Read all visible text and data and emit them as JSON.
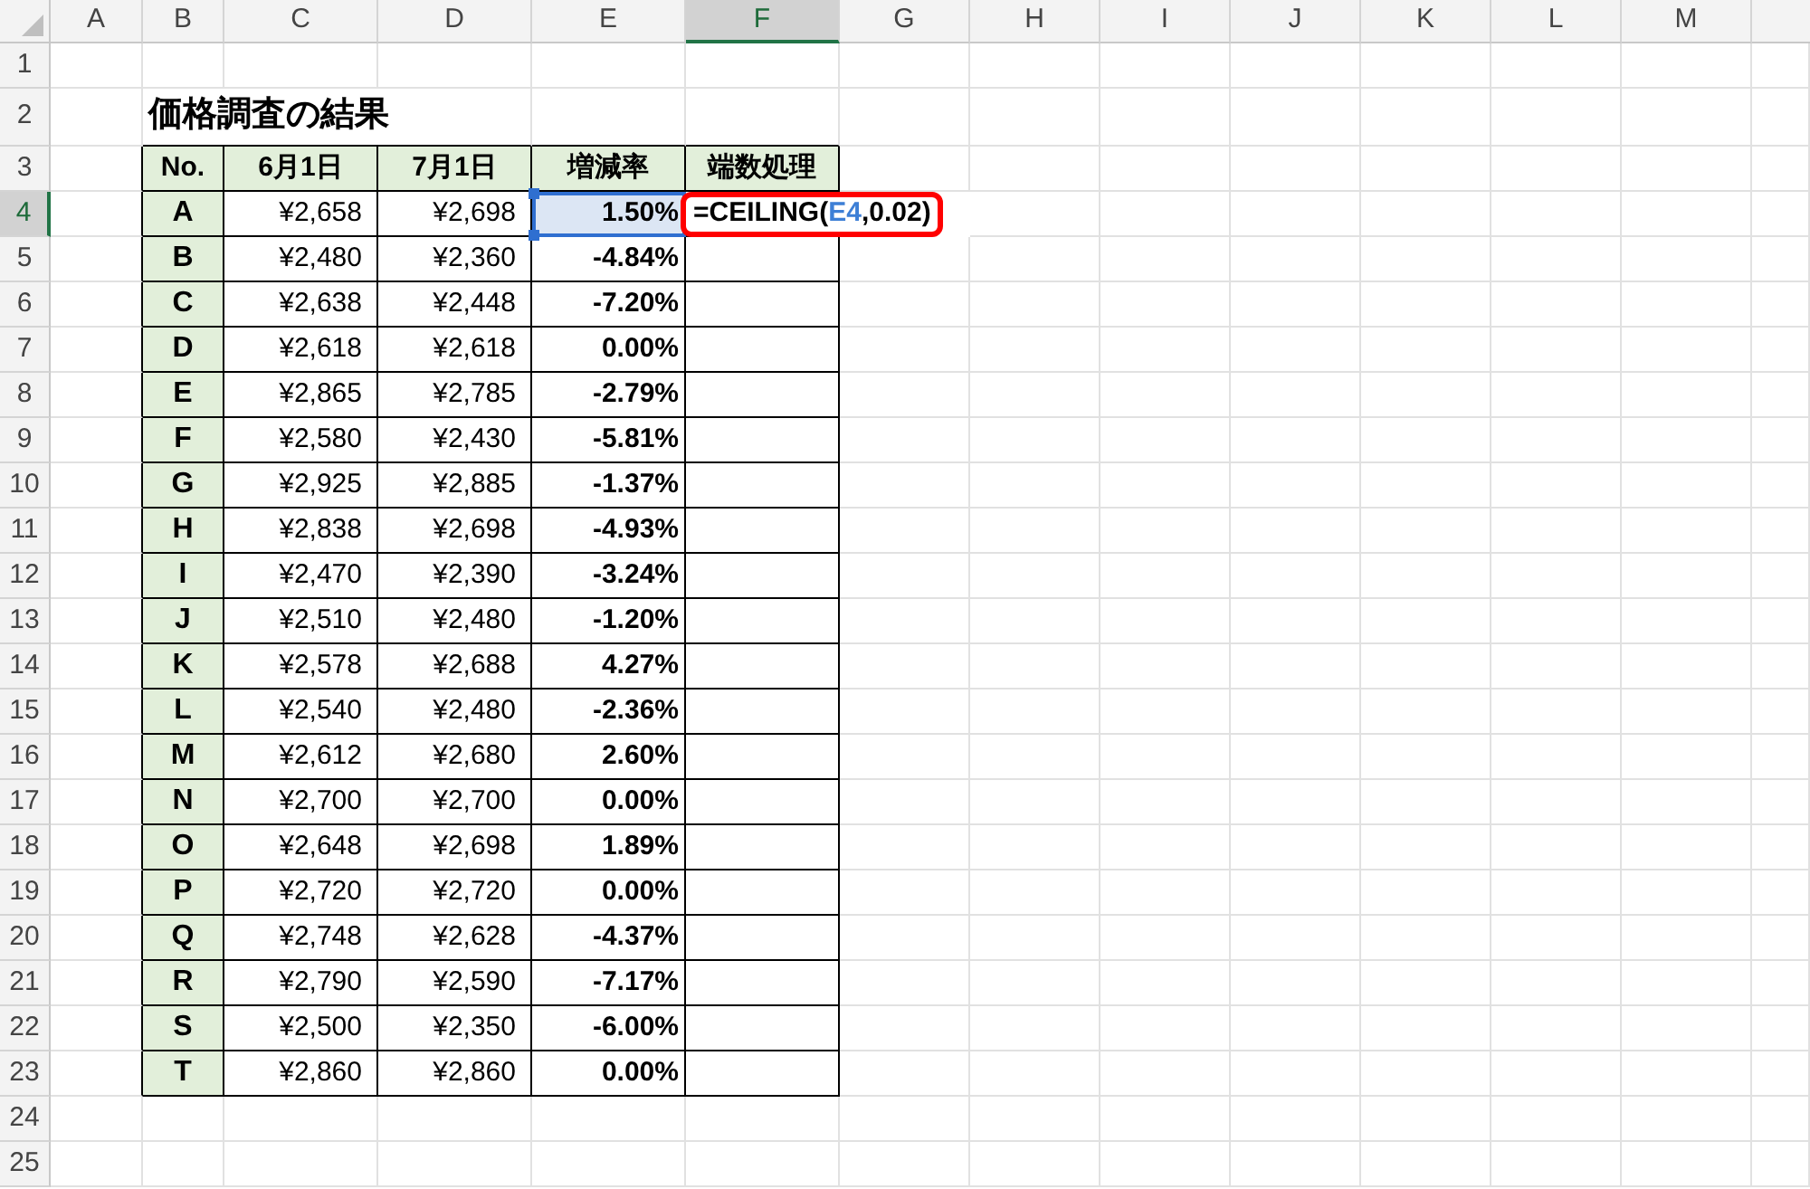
{
  "column_headers": [
    {
      "label": "A",
      "selected": false
    },
    {
      "label": "B",
      "selected": false
    },
    {
      "label": "C",
      "selected": false
    },
    {
      "label": "D",
      "selected": false
    },
    {
      "label": "E",
      "selected": false
    },
    {
      "label": "F",
      "selected": true
    },
    {
      "label": "G",
      "selected": false
    },
    {
      "label": "H",
      "selected": false
    },
    {
      "label": "I",
      "selected": false
    },
    {
      "label": "J",
      "selected": false
    },
    {
      "label": "K",
      "selected": false
    },
    {
      "label": "L",
      "selected": false
    },
    {
      "label": "M",
      "selected": false
    }
  ],
  "row_headers": [
    {
      "label": "1",
      "selected": false
    },
    {
      "label": "2",
      "selected": false
    },
    {
      "label": "3",
      "selected": false
    },
    {
      "label": "4",
      "selected": true
    },
    {
      "label": "5",
      "selected": false
    },
    {
      "label": "6",
      "selected": false
    },
    {
      "label": "7",
      "selected": false
    },
    {
      "label": "8",
      "selected": false
    },
    {
      "label": "9",
      "selected": false
    },
    {
      "label": "10",
      "selected": false
    },
    {
      "label": "11",
      "selected": false
    },
    {
      "label": "12",
      "selected": false
    },
    {
      "label": "13",
      "selected": false
    },
    {
      "label": "14",
      "selected": false
    },
    {
      "label": "15",
      "selected": false
    },
    {
      "label": "16",
      "selected": false
    },
    {
      "label": "17",
      "selected": false
    },
    {
      "label": "18",
      "selected": false
    },
    {
      "label": "19",
      "selected": false
    },
    {
      "label": "20",
      "selected": false
    },
    {
      "label": "21",
      "selected": false
    },
    {
      "label": "22",
      "selected": false
    },
    {
      "label": "23",
      "selected": false
    },
    {
      "label": "24",
      "selected": false
    },
    {
      "label": "25",
      "selected": false
    }
  ],
  "title": "価格調査の結果",
  "table": {
    "columns": [
      "No.",
      "6月1日",
      "7月1日",
      "増減率",
      "端数処理"
    ],
    "rows": [
      {
        "no": "A",
        "june_1": "¥2,658",
        "july_1": "¥2,698",
        "change_rate": "1.50%",
        "selected": true
      },
      {
        "no": "B",
        "june_1": "¥2,480",
        "july_1": "¥2,360",
        "change_rate": "-4.84%",
        "selected": false
      },
      {
        "no": "C",
        "june_1": "¥2,638",
        "july_1": "¥2,448",
        "change_rate": "-7.20%",
        "selected": false
      },
      {
        "no": "D",
        "june_1": "¥2,618",
        "july_1": "¥2,618",
        "change_rate": "0.00%",
        "selected": false
      },
      {
        "no": "E",
        "june_1": "¥2,865",
        "july_1": "¥2,785",
        "change_rate": "-2.79%",
        "selected": false
      },
      {
        "no": "F",
        "june_1": "¥2,580",
        "july_1": "¥2,430",
        "change_rate": "-5.81%",
        "selected": false
      },
      {
        "no": "G",
        "june_1": "¥2,925",
        "july_1": "¥2,885",
        "change_rate": "-1.37%",
        "selected": false
      },
      {
        "no": "H",
        "june_1": "¥2,838",
        "july_1": "¥2,698",
        "change_rate": "-4.93%",
        "selected": false
      },
      {
        "no": "I",
        "june_1": "¥2,470",
        "july_1": "¥2,390",
        "change_rate": "-3.24%",
        "selected": false
      },
      {
        "no": "J",
        "june_1": "¥2,510",
        "july_1": "¥2,480",
        "change_rate": "-1.20%",
        "selected": false
      },
      {
        "no": "K",
        "june_1": "¥2,578",
        "july_1": "¥2,688",
        "change_rate": "4.27%",
        "selected": false
      },
      {
        "no": "L",
        "june_1": "¥2,540",
        "july_1": "¥2,480",
        "change_rate": "-2.36%",
        "selected": false
      },
      {
        "no": "M",
        "june_1": "¥2,612",
        "july_1": "¥2,680",
        "change_rate": "2.60%",
        "selected": false
      },
      {
        "no": "N",
        "june_1": "¥2,700",
        "july_1": "¥2,700",
        "change_rate": "0.00%",
        "selected": false
      },
      {
        "no": "O",
        "june_1": "¥2,648",
        "july_1": "¥2,698",
        "change_rate": "1.89%",
        "selected": false
      },
      {
        "no": "P",
        "june_1": "¥2,720",
        "july_1": "¥2,720",
        "change_rate": "0.00%",
        "selected": false
      },
      {
        "no": "Q",
        "june_1": "¥2,748",
        "july_1": "¥2,628",
        "change_rate": "-4.37%",
        "selected": false
      },
      {
        "no": "R",
        "june_1": "¥2,790",
        "july_1": "¥2,590",
        "change_rate": "-7.17%",
        "selected": false
      },
      {
        "no": "S",
        "june_1": "¥2,500",
        "july_1": "¥2,350",
        "change_rate": "-6.00%",
        "selected": false
      },
      {
        "no": "T",
        "june_1": "¥2,860",
        "july_1": "¥2,860",
        "change_rate": "0.00%",
        "selected": false
      }
    ]
  },
  "formula_edit": {
    "parts": [
      {
        "kind": "text",
        "text": "=CEILING("
      },
      {
        "kind": "ref",
        "text": "E4"
      },
      {
        "kind": "text",
        "text": ",0.02)"
      }
    ]
  }
}
